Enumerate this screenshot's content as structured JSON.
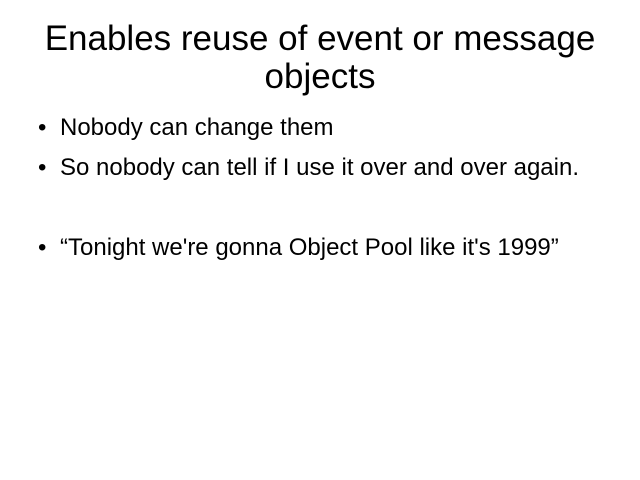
{
  "slide": {
    "title": "Enables reuse of event or message objects",
    "bullet_symbol": "•",
    "bullets": [
      "Nobody can change them",
      "So nobody can tell if I use it over and over again.",
      "“Tonight we're gonna Object Pool like it's 1999”"
    ]
  }
}
